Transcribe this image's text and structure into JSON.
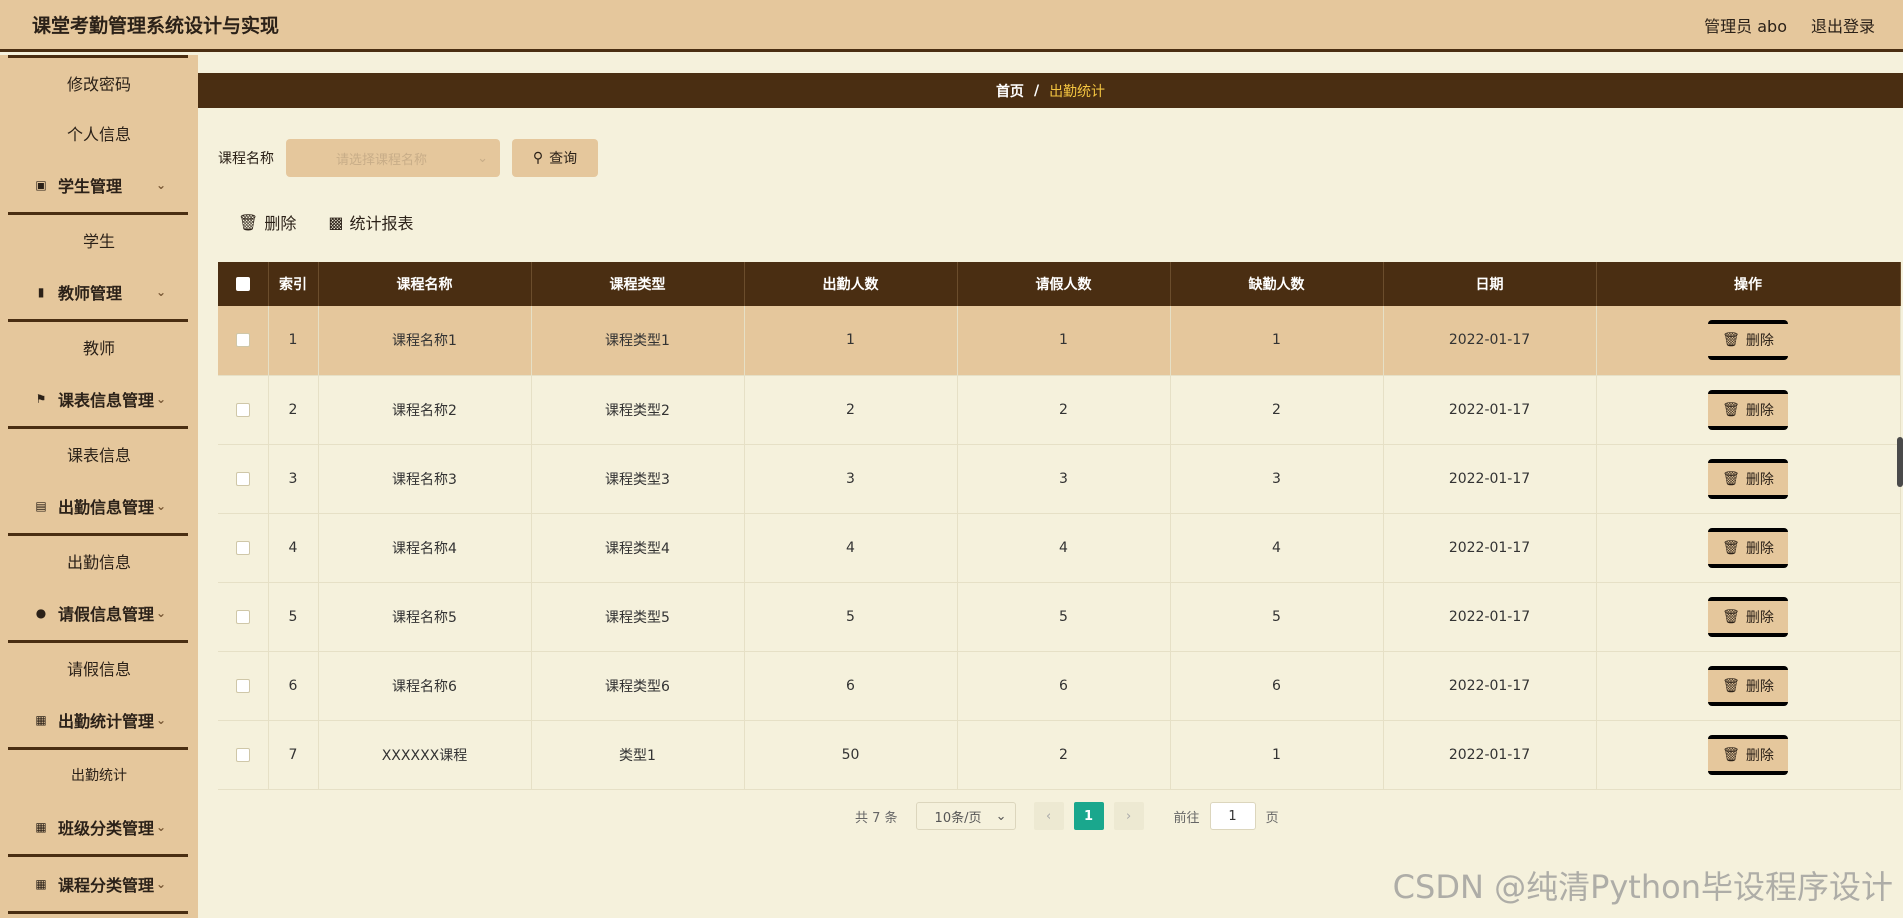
{
  "app": {
    "title": "课堂考勤管理系统设计与实现"
  },
  "header": {
    "user_label": "管理员 abo",
    "logout_label": "退出登录"
  },
  "sidebar": {
    "items": [
      {
        "type": "sub",
        "label": "修改密码"
      },
      {
        "type": "sub",
        "label": "个人信息"
      },
      {
        "type": "group",
        "label": "学生管理",
        "icon": "briefcase-icon"
      },
      {
        "type": "sub",
        "label": "学生"
      },
      {
        "type": "group",
        "label": "教师管理",
        "icon": "bar-icon"
      },
      {
        "type": "sub",
        "label": "教师"
      },
      {
        "type": "group",
        "label": "课表信息管理",
        "icon": "flag-icon"
      },
      {
        "type": "sub",
        "label": "课表信息"
      },
      {
        "type": "group",
        "label": "出勤信息管理",
        "icon": "case-icon"
      },
      {
        "type": "sub",
        "label": "出勤信息"
      },
      {
        "type": "group",
        "label": "请假信息管理",
        "icon": "bulb-icon"
      },
      {
        "type": "sub",
        "label": "请假信息"
      },
      {
        "type": "group",
        "label": "出勤统计管理",
        "icon": "grid-icon"
      },
      {
        "type": "sub",
        "label": "出勤统计"
      },
      {
        "type": "group",
        "label": "班级分类管理",
        "icon": "grid-icon"
      },
      {
        "type": "group",
        "label": "课程分类管理",
        "icon": "grid-icon"
      }
    ]
  },
  "breadcrumb": {
    "home": "首页",
    "separator": "/",
    "current": "出勤统计"
  },
  "search": {
    "label": "课程名称",
    "placeholder": "请选择课程名称",
    "query_label": "查询"
  },
  "actions": {
    "delete_label": "删除",
    "report_label": "统计报表"
  },
  "table": {
    "headers": [
      "索引",
      "课程名称",
      "课程类型",
      "出勤人数",
      "请假人数",
      "缺勤人数",
      "日期",
      "操作"
    ],
    "rows": [
      {
        "index": "1",
        "course": "课程名称1",
        "type": "课程类型1",
        "present": "1",
        "leave": "1",
        "absent": "1",
        "date": "2022-01-17"
      },
      {
        "index": "2",
        "course": "课程名称2",
        "type": "课程类型2",
        "present": "2",
        "leave": "2",
        "absent": "2",
        "date": "2022-01-17"
      },
      {
        "index": "3",
        "course": "课程名称3",
        "type": "课程类型3",
        "present": "3",
        "leave": "3",
        "absent": "3",
        "date": "2022-01-17"
      },
      {
        "index": "4",
        "course": "课程名称4",
        "type": "课程类型4",
        "present": "4",
        "leave": "4",
        "absent": "4",
        "date": "2022-01-17"
      },
      {
        "index": "5",
        "course": "课程名称5",
        "type": "课程类型5",
        "present": "5",
        "leave": "5",
        "absent": "5",
        "date": "2022-01-17"
      },
      {
        "index": "6",
        "course": "课程名称6",
        "type": "课程类型6",
        "present": "6",
        "leave": "6",
        "absent": "6",
        "date": "2022-01-17"
      },
      {
        "index": "7",
        "course": "XXXXXX课程",
        "type": "类型1",
        "present": "50",
        "leave": "2",
        "absent": "1",
        "date": "2022-01-17"
      }
    ],
    "row_delete_label": "删除"
  },
  "pagination": {
    "total_label": "共 7 条",
    "page_size": "10条/页",
    "current_page": "1",
    "goto_prefix": "前往",
    "goto_value": "1",
    "goto_suffix": "页"
  },
  "watermark": "CSDN @纯清Python毕设程序设计",
  "colors": {
    "accent": "#e5c79c",
    "dark": "#4a2e12",
    "background": "#f5f1dc",
    "active_page": "#1aa78d",
    "breadcrumb_current": "#f3c440"
  }
}
